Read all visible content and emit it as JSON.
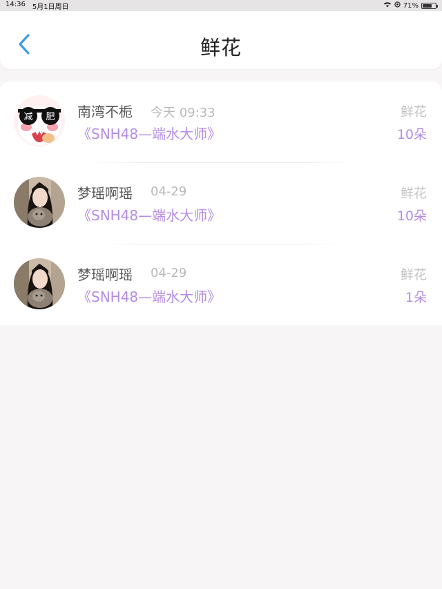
{
  "status_bar": {
    "time": "14:36",
    "date": "5月1日周日",
    "battery": "71%",
    "battery_level": 0.71
  },
  "nav": {
    "title": "鲜花",
    "back_icon": "chevron-left-icon",
    "accent": "#3a9be6"
  },
  "records": [
    {
      "name": "南湾不栀",
      "time": "今天 09:33",
      "gift": "鲜花",
      "title": "《SNH48—端水大师》",
      "count": "10朵",
      "avatar_text_left": "减",
      "avatar_text_right": "肥"
    },
    {
      "name": "梦瑶啊瑶",
      "time": "04-29",
      "gift": "鲜花",
      "title": "《SNH48—端水大师》",
      "count": "10朵"
    },
    {
      "name": "梦瑶啊瑶",
      "time": "04-29",
      "gift": "鲜花",
      "title": "《SNH48—端水大师》",
      "count": "1朵"
    }
  ],
  "colors": {
    "link": "#b48be6",
    "muted": "#b9b9b9",
    "background": "#f7f5f6"
  }
}
